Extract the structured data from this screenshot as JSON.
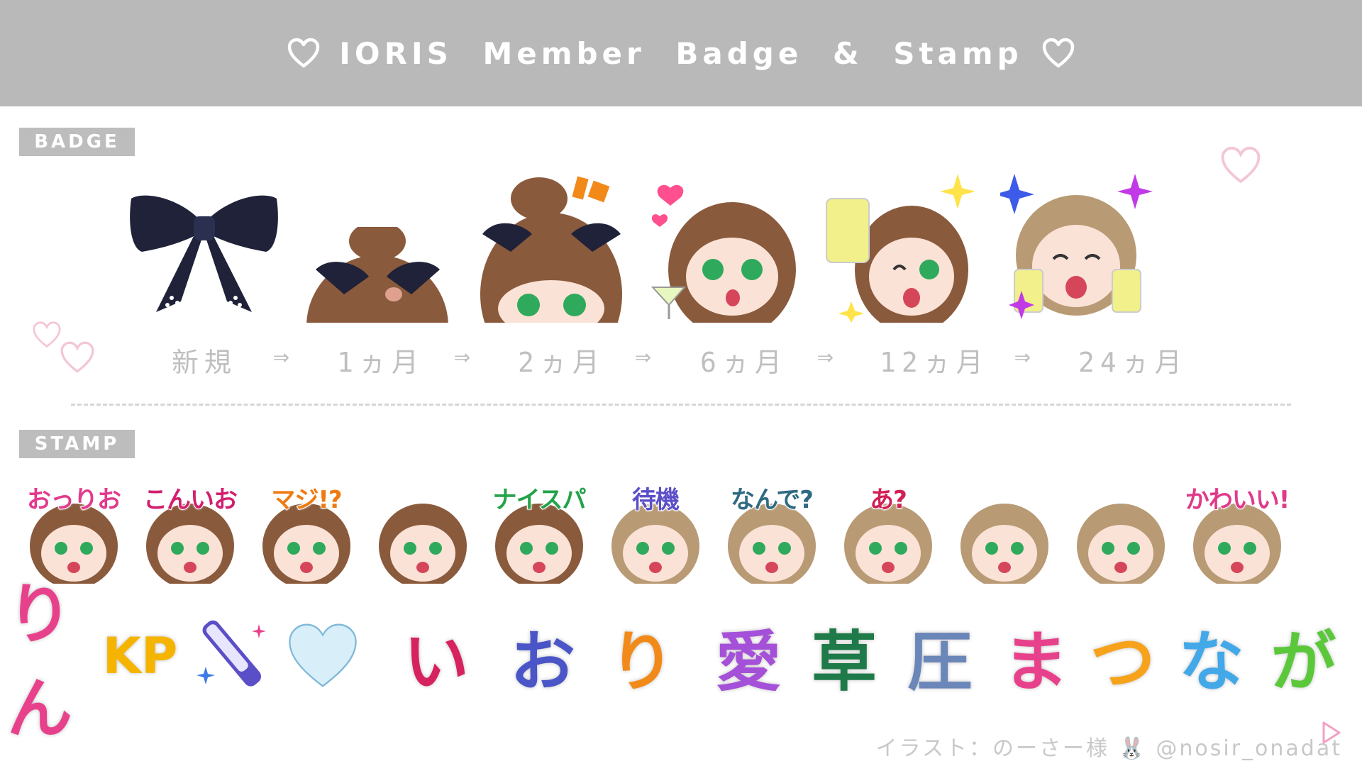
{
  "header": {
    "title": "IORIS  Member  Badge & Stamp"
  },
  "badge_section": {
    "label": "BADGE",
    "badges": [
      {
        "name": "bow"
      },
      {
        "name": "peek-1"
      },
      {
        "name": "peek-2"
      },
      {
        "name": "martini"
      },
      {
        "name": "cheers"
      },
      {
        "name": "double-cheers"
      }
    ],
    "months": [
      "新規",
      "1ヵ月",
      "2ヵ月",
      "6ヵ月",
      "12ヵ月",
      "24ヵ月"
    ],
    "arrow": "⇒"
  },
  "stamp_section": {
    "label": "STAMP",
    "stamps": [
      {
        "text": "おっりお",
        "color": "#e23a8c"
      },
      {
        "text": "こんいお",
        "color": "#d21f6e"
      },
      {
        "text": "マジ!?",
        "color": "#f07a12"
      },
      {
        "text": "",
        "color": "#f07a12"
      },
      {
        "text": "ナイスパ",
        "color": "#23a34a"
      },
      {
        "text": "待機",
        "color": "#5b4fc8"
      },
      {
        "text": "なんで?",
        "color": "#2f6a82"
      },
      {
        "text": "あ?",
        "color": "#d21f56"
      },
      {
        "text": "",
        "color": "#888888"
      },
      {
        "text": "",
        "color": "#f07a12"
      },
      {
        "text": "かわいい!",
        "color": "#e03a8a"
      }
    ]
  },
  "emotes": [
    {
      "text": "りん",
      "color": "#e8418c"
    },
    {
      "text": "KP",
      "color": "#f5b400"
    },
    {
      "text": "",
      "color": "#5b4fc8"
    },
    {
      "text": "",
      "color": "#bfe4f5"
    },
    {
      "text": "い",
      "color": "#d6225f"
    },
    {
      "text": "お",
      "color": "#4a55c8"
    },
    {
      "text": "り",
      "color": "#f28a1a"
    },
    {
      "text": "愛",
      "color": "#a550d8"
    },
    {
      "text": "草",
      "color": "#1f7a4a"
    },
    {
      "text": "圧",
      "color": "#6b86b8"
    },
    {
      "text": "ま",
      "color": "#e8418c"
    },
    {
      "text": "つ",
      "color": "#f6a21a"
    },
    {
      "text": "な",
      "color": "#42a8e8"
    },
    {
      "text": "が",
      "color": "#5ac83a"
    }
  ],
  "credit": "イラスト：のーさー様 🐰 @nosir_onadat",
  "colors": {
    "header_bg": "#b9b9b9",
    "label_bg": "#bdbdbd",
    "month_text": "#bfbfbf",
    "hair": "#8a5a3c",
    "hair_light": "#b89a74",
    "bow": "#1f2238"
  }
}
